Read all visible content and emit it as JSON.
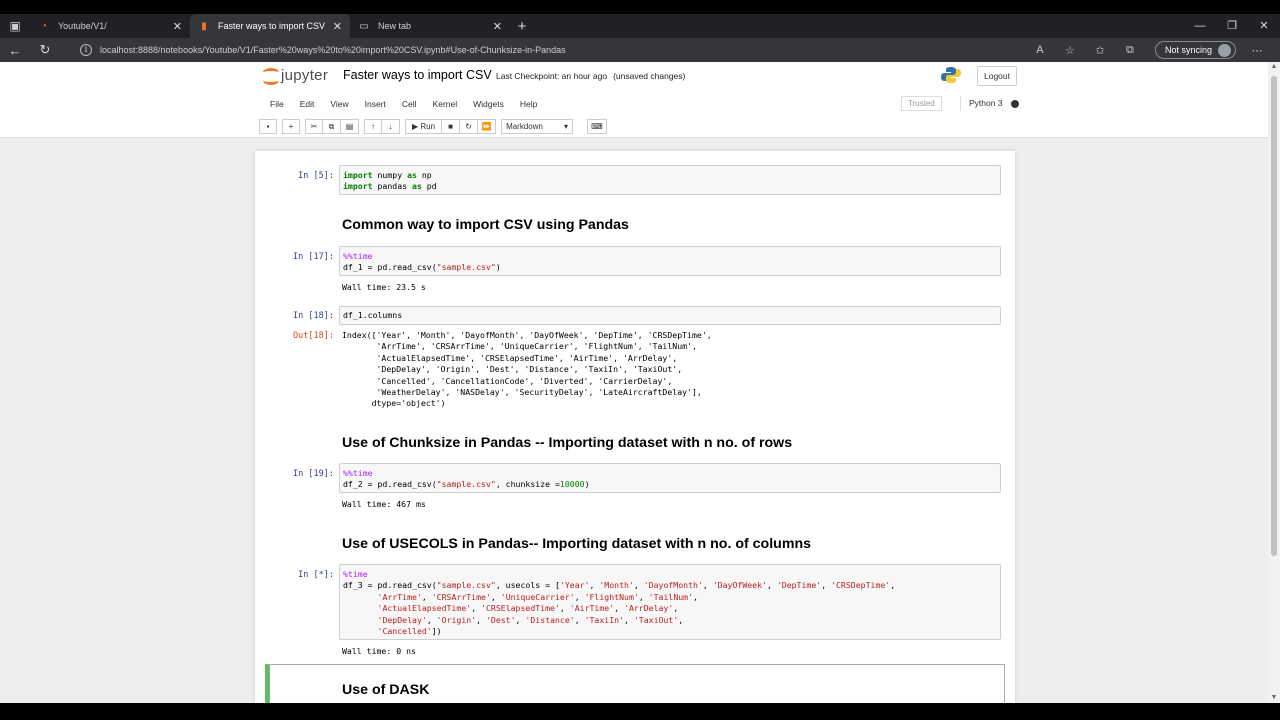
{
  "browser": {
    "tabs": [
      {
        "title": "Youtube/V1/",
        "active": false
      },
      {
        "title": "Faster ways to import CSV - Jupy",
        "active": true
      },
      {
        "title": "New tab",
        "active": false
      }
    ],
    "url": "localhost:8888/notebooks/Youtube/V1/Faster%20ways%20to%20import%20CSV.ipynb#Use-of-Chunksize-in-Pandas",
    "sync_label": "Not syncing"
  },
  "jupyter": {
    "logo_text": "jupyter",
    "notebook_title": "Faster ways to import CSV",
    "checkpoint": "Last Checkpoint: an hour ago",
    "unsaved": "(unsaved changes)",
    "logout_label": "Logout",
    "menu": [
      "File",
      "Edit",
      "View",
      "Insert",
      "Cell",
      "Kernel",
      "Widgets",
      "Help"
    ],
    "trusted": "Trusted",
    "kernel_name": "Python 3",
    "toolbar": {
      "run_label": "Run",
      "cell_type": "Markdown"
    }
  },
  "cells": {
    "c1": {
      "prompt": "In [5]:"
    },
    "h1": "Common way to import CSV using Pandas",
    "c2": {
      "prompt": "In [17]:",
      "output": "Wall time: 23.5 s"
    },
    "c3": {
      "prompt": "In [18]:",
      "code": "df_1.columns",
      "out_prompt": "Out[18]:"
    },
    "h2": "Use of Chunksize in Pandas -- Importing dataset with n no. of rows",
    "c4": {
      "prompt": "In [19]:",
      "output": "Wall time: 467 ms"
    },
    "h3": "Use of USECOLS in Pandas-- Importing dataset with n no. of columns",
    "c5": {
      "prompt": "In [*]:",
      "output": "Wall time: 0 ns"
    },
    "h4": "Use of DASK"
  },
  "colors": {
    "accent": "#f37626",
    "selected_cell": "#66bb6a",
    "in_prompt": "#303f9f",
    "out_prompt": "#d84315"
  }
}
